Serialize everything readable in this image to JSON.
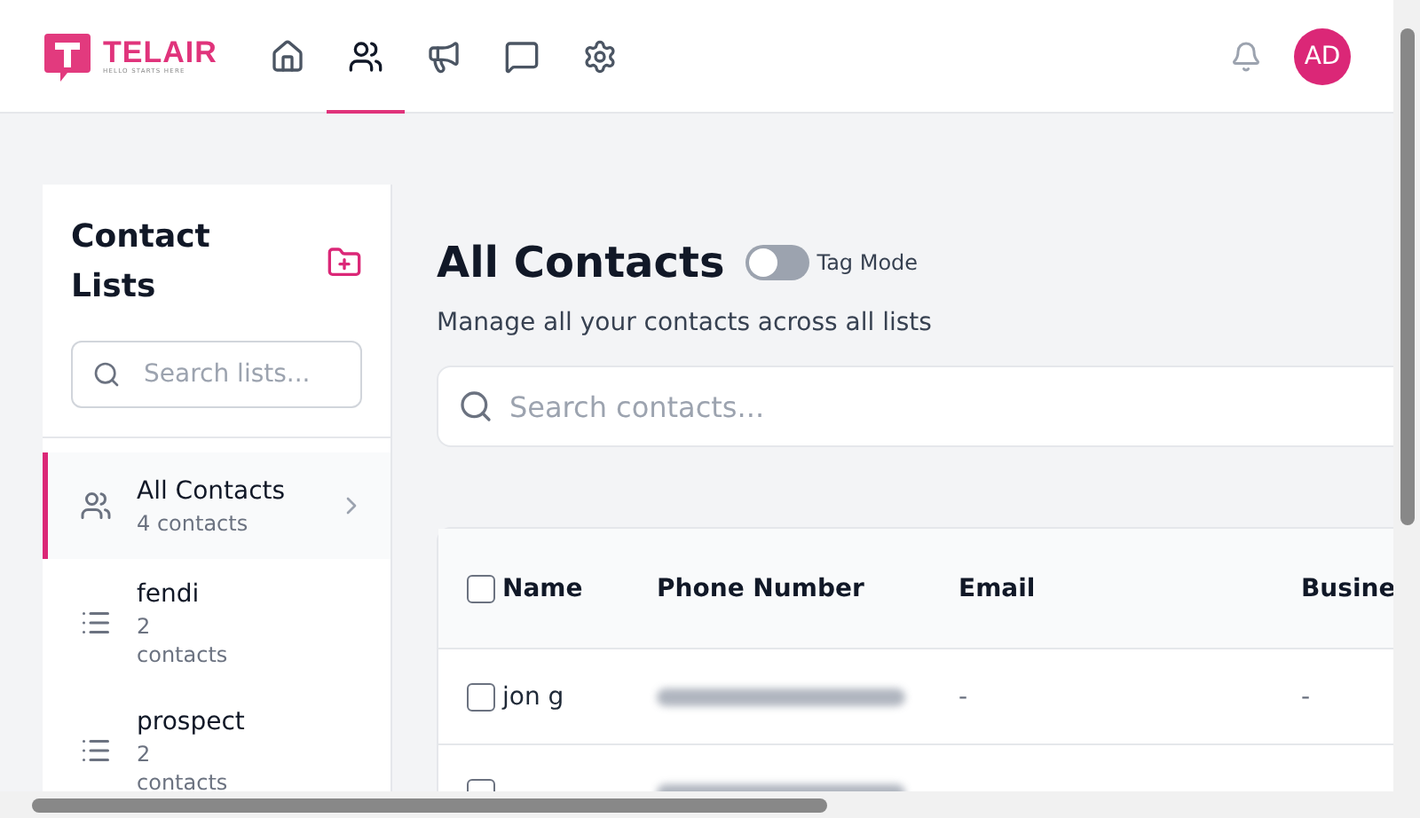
{
  "brand": {
    "name": "TELAIR",
    "tagline": "HELLO STARTS HERE"
  },
  "nav": [
    {
      "kind": "home",
      "selected": false
    },
    {
      "kind": "users",
      "selected": true
    },
    {
      "kind": "megaphone",
      "selected": false
    },
    {
      "kind": "chat",
      "selected": false
    },
    {
      "kind": "settings",
      "selected": false
    }
  ],
  "avatar": "AD",
  "sidebar": {
    "title": "Contact Lists",
    "search": {
      "placeholder": "Search lists..."
    },
    "items": [
      {
        "kind": "all",
        "name": "All Contacts",
        "count": "4 contacts",
        "selected": true
      },
      {
        "kind": "list",
        "name": "fendi",
        "count": "2\ncontacts",
        "selected": false
      },
      {
        "kind": "list",
        "name": "prospect",
        "count": "2\ncontacts",
        "selected": false
      }
    ]
  },
  "main": {
    "title": "All Contacts",
    "tag_mode": {
      "label": "Tag Mode",
      "on": false
    },
    "subtitle": "Manage all your contacts across all lists",
    "search": {
      "placeholder": "Search contacts..."
    }
  },
  "table": {
    "select_all": false,
    "columns": [
      "Name",
      "Phone Number",
      "Email",
      "Busine"
    ],
    "rows": [
      {
        "name": "jon g",
        "email": "-",
        "business": "-",
        "checked": false
      },
      {
        "checked": false
      }
    ]
  }
}
